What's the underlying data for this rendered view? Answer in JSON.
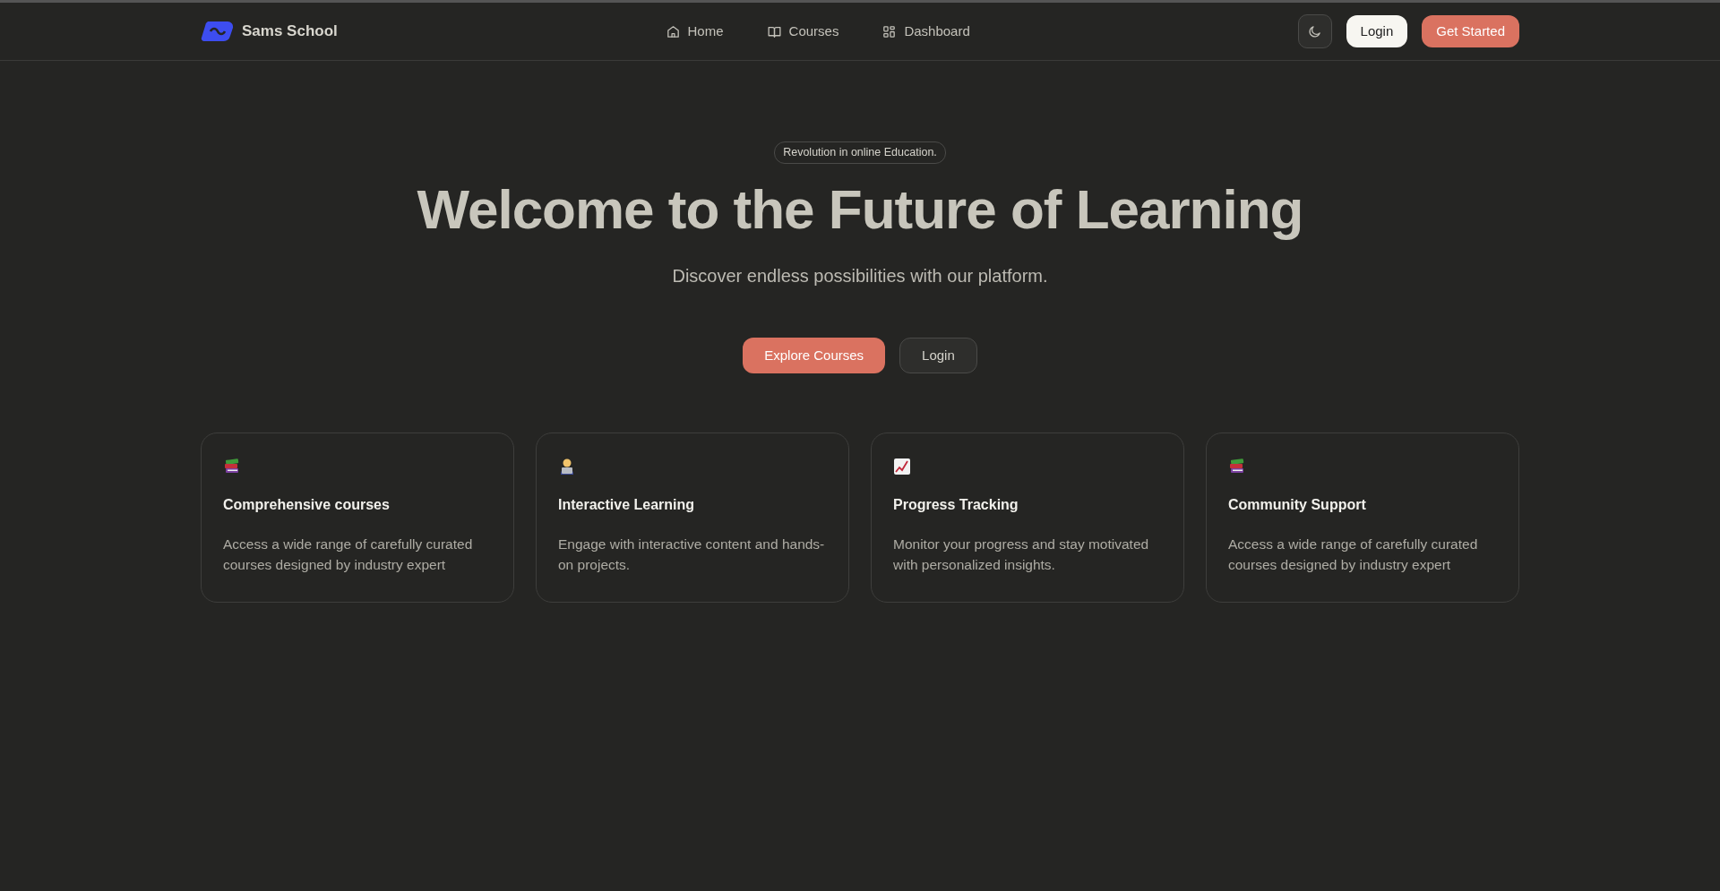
{
  "brand": {
    "name": "Sams School"
  },
  "nav": [
    {
      "label": "Home",
      "kind": "home"
    },
    {
      "label": "Courses",
      "kind": "book"
    },
    {
      "label": "Dashboard",
      "kind": "grid"
    }
  ],
  "actions": {
    "login": "Login",
    "get_started": "Get Started"
  },
  "hero": {
    "badge": "Revolution in online Education.",
    "title": "Welcome to the Future of Learning",
    "subtitle": "Discover endless possibilities with our platform.",
    "primary_button": "Explore Courses",
    "secondary_button": "Login"
  },
  "features": [
    {
      "kind": "books",
      "title": "Comprehensive courses",
      "text": "Access a wide range of carefully curated courses designed by industry expert"
    },
    {
      "kind": "person",
      "title": "Interactive Learning",
      "text": "Engage with interactive content and hands-on projects."
    },
    {
      "kind": "chart",
      "title": "Progress Tracking",
      "text": "Monitor your progress and stay motivated with personalized insights."
    },
    {
      "kind": "books",
      "title": "Community Support",
      "text": "Access a wide range of carefully curated courses designed by industry expert"
    }
  ]
}
